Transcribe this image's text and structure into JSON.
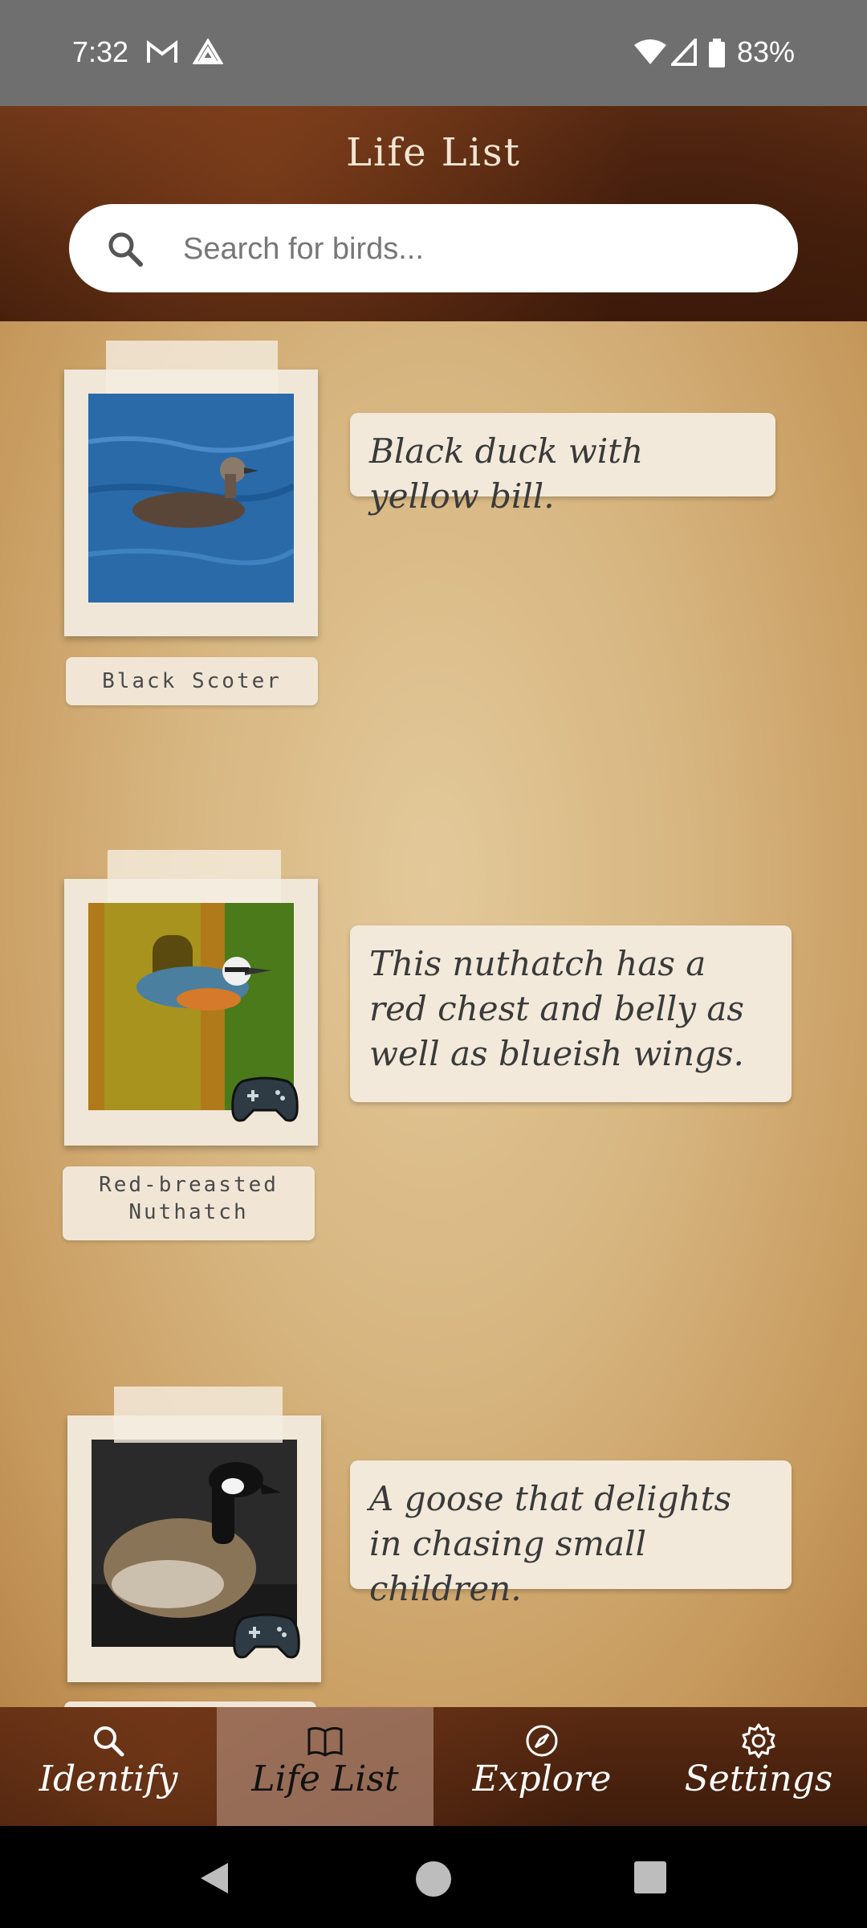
{
  "status": {
    "time": "7:32",
    "battery": "83%"
  },
  "header": {
    "title": "Life List"
  },
  "search": {
    "placeholder": "Search for birds..."
  },
  "entries": [
    {
      "name": "Black Scoter",
      "note": "Black duck with yellow bill.",
      "game_icon": false
    },
    {
      "name": "Red-breasted Nuthatch",
      "note": "This nuthatch has a red chest and belly as well as blueish wings.",
      "game_icon": true
    },
    {
      "name": "",
      "note": "A goose that delights in chasing small children.",
      "game_icon": true
    }
  ],
  "tabs": [
    {
      "label": "Identify",
      "icon": "search-icon",
      "active": false
    },
    {
      "label": "Life List",
      "icon": "book-icon",
      "active": true
    },
    {
      "label": "Explore",
      "icon": "compass-icon",
      "active": false
    },
    {
      "label": "Settings",
      "icon": "gear-icon",
      "active": false
    }
  ],
  "colors": {
    "header_bg": "#4a220e",
    "paper": "#d6b47e",
    "active_tab": "#a9887a"
  }
}
